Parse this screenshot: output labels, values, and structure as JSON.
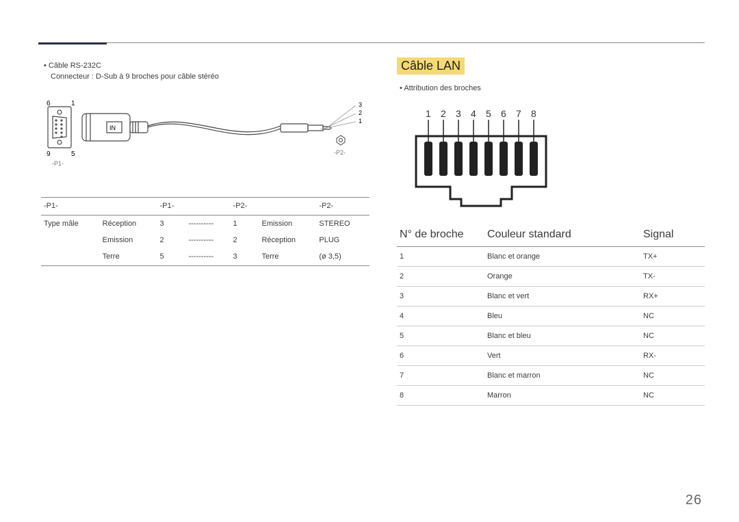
{
  "page_number": "26",
  "left": {
    "bullet": "Câble RS-232C",
    "subtitle": "Connecteur : D-Sub à 9 broches pour câble stéréo",
    "diagram_labels": {
      "p1_top_left": "6",
      "p1_top_right": "1",
      "p1_bottom_left": "9",
      "p1_bottom_right": "5",
      "p1_caption": "-P1-",
      "p2_lines": [
        "3",
        "2",
        "1"
      ],
      "p2_caption": "-P2-",
      "in_label": "IN"
    },
    "table": {
      "header": [
        "-P1-",
        "",
        "-P1-",
        "",
        "-P2-",
        "",
        "-P2-"
      ],
      "rows": [
        [
          "Type mâle",
          "Réception",
          "3",
          "----------",
          "1",
          "Emission",
          "STEREO"
        ],
        [
          "",
          "Emission",
          "2",
          "----------",
          "2",
          "Réception",
          "PLUG"
        ],
        [
          "",
          "Terre",
          "5",
          "----------",
          "3",
          "Terre",
          "(ø 3,5)"
        ]
      ]
    }
  },
  "right": {
    "section_title": "Câble LAN",
    "bullet": "Attribution des broches",
    "pin_numbers": [
      "1",
      "2",
      "3",
      "4",
      "5",
      "6",
      "7",
      "8"
    ],
    "table": {
      "headers": [
        "N° de broche",
        "Couleur standard",
        "Signal"
      ],
      "rows": [
        [
          "1",
          "Blanc et orange",
          "TX+"
        ],
        [
          "2",
          "Orange",
          "TX-"
        ],
        [
          "3",
          "Blanc et vert",
          "RX+"
        ],
        [
          "4",
          "Bleu",
          "NC"
        ],
        [
          "5",
          "Blanc et bleu",
          "NC"
        ],
        [
          "6",
          "Vert",
          "RX-"
        ],
        [
          "7",
          "Blanc et marron",
          "NC"
        ],
        [
          "8",
          "Marron",
          "NC"
        ]
      ]
    }
  }
}
